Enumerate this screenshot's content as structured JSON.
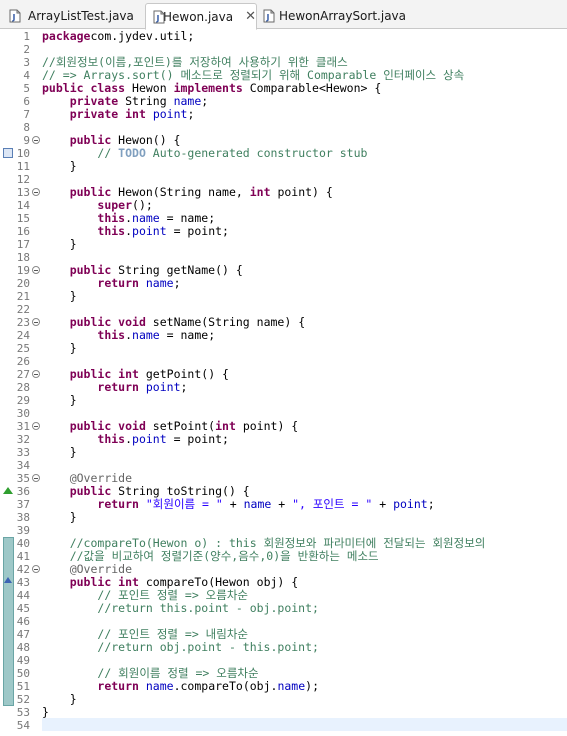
{
  "tabs": [
    {
      "label": "ArrayListTest.java",
      "active": false
    },
    {
      "label": "Hewon.java",
      "active": true,
      "close": "✕"
    },
    {
      "label": "HewonArraySort.java",
      "active": false
    }
  ],
  "editor": {
    "lines": [
      {
        "n": "1",
        "t": [
          [
            "kw",
            "package"
          ],
          [
            "",
            "com.jydev.util;"
          ]
        ]
      },
      {
        "n": "2",
        "t": []
      },
      {
        "n": "3",
        "t": [
          [
            "cm",
            "//회원정보(이름,포인트)를 저장하여 사용하기 위한 클래스"
          ]
        ]
      },
      {
        "n": "4",
        "t": [
          [
            "cm",
            "// => Arrays.sort() 메소드로 정렬되기 위해 Comparable 인터페이스 상속"
          ]
        ]
      },
      {
        "n": "5",
        "t": [
          [
            "kw",
            "public class"
          ],
          [
            "",
            " Hewon "
          ],
          [
            "kw",
            "implements"
          ],
          [
            "",
            " Comparable<Hewon> {"
          ]
        ]
      },
      {
        "n": "6",
        "t": [
          [
            "",
            "    "
          ],
          [
            "kw",
            "private"
          ],
          [
            "",
            " String "
          ],
          [
            "fld",
            "name"
          ],
          [
            "",
            ";"
          ]
        ]
      },
      {
        "n": "7",
        "t": [
          [
            "",
            "    "
          ],
          [
            "kw",
            "private int"
          ],
          [
            "",
            " "
          ],
          [
            "fld",
            "point"
          ],
          [
            "",
            ";"
          ]
        ]
      },
      {
        "n": "8",
        "t": []
      },
      {
        "n": "9",
        "fold": true,
        "t": [
          [
            "",
            "    "
          ],
          [
            "kw",
            "public"
          ],
          [
            "",
            " Hewon() {"
          ]
        ]
      },
      {
        "n": "10",
        "t": [
          [
            "",
            "        "
          ],
          [
            "cm",
            "// "
          ],
          [
            "task",
            "TODO"
          ],
          [
            "cm",
            " Auto-generated constructor stub"
          ]
        ]
      },
      {
        "n": "11",
        "t": [
          [
            "",
            "    }"
          ]
        ]
      },
      {
        "n": "12",
        "t": []
      },
      {
        "n": "13",
        "fold": true,
        "t": [
          [
            "",
            "    "
          ],
          [
            "kw",
            "public"
          ],
          [
            "",
            " Hewon(String name, "
          ],
          [
            "kw",
            "int"
          ],
          [
            "",
            " point) {"
          ]
        ]
      },
      {
        "n": "14",
        "t": [
          [
            "",
            "        "
          ],
          [
            "kw",
            "super"
          ],
          [
            "",
            "();"
          ]
        ]
      },
      {
        "n": "15",
        "t": [
          [
            "",
            "        "
          ],
          [
            "kw",
            "this"
          ],
          [
            "",
            "."
          ],
          [
            "fld",
            "name"
          ],
          [
            "",
            " = name;"
          ]
        ]
      },
      {
        "n": "16",
        "t": [
          [
            "",
            "        "
          ],
          [
            "kw",
            "this"
          ],
          [
            "",
            "."
          ],
          [
            "fld",
            "point"
          ],
          [
            "",
            " = point;"
          ]
        ]
      },
      {
        "n": "17",
        "t": [
          [
            "",
            "    }"
          ]
        ]
      },
      {
        "n": "18",
        "t": []
      },
      {
        "n": "19",
        "fold": true,
        "t": [
          [
            "",
            "    "
          ],
          [
            "kw",
            "public"
          ],
          [
            "",
            " String getName() {"
          ]
        ]
      },
      {
        "n": "20",
        "t": [
          [
            "",
            "        "
          ],
          [
            "kw",
            "return"
          ],
          [
            "",
            " "
          ],
          [
            "fld",
            "name"
          ],
          [
            "",
            ";"
          ]
        ]
      },
      {
        "n": "21",
        "t": [
          [
            "",
            "    }"
          ]
        ]
      },
      {
        "n": "22",
        "t": []
      },
      {
        "n": "23",
        "fold": true,
        "t": [
          [
            "",
            "    "
          ],
          [
            "kw",
            "public void"
          ],
          [
            "",
            " setName(String name) {"
          ]
        ]
      },
      {
        "n": "24",
        "t": [
          [
            "",
            "        "
          ],
          [
            "kw",
            "this"
          ],
          [
            "",
            "."
          ],
          [
            "fld",
            "name"
          ],
          [
            "",
            " = name;"
          ]
        ]
      },
      {
        "n": "25",
        "t": [
          [
            "",
            "    }"
          ]
        ]
      },
      {
        "n": "26",
        "t": []
      },
      {
        "n": "27",
        "fold": true,
        "t": [
          [
            "",
            "    "
          ],
          [
            "kw",
            "public int"
          ],
          [
            "",
            " getPoint() {"
          ]
        ]
      },
      {
        "n": "28",
        "t": [
          [
            "",
            "        "
          ],
          [
            "kw",
            "return"
          ],
          [
            "",
            " "
          ],
          [
            "fld",
            "point"
          ],
          [
            "",
            ";"
          ]
        ]
      },
      {
        "n": "29",
        "t": [
          [
            "",
            "    }"
          ]
        ]
      },
      {
        "n": "30",
        "t": []
      },
      {
        "n": "31",
        "fold": true,
        "t": [
          [
            "",
            "    "
          ],
          [
            "kw",
            "public void"
          ],
          [
            "",
            " setPoint("
          ],
          [
            "kw",
            "int"
          ],
          [
            "",
            " point) {"
          ]
        ]
      },
      {
        "n": "32",
        "t": [
          [
            "",
            "        "
          ],
          [
            "kw",
            "this"
          ],
          [
            "",
            "."
          ],
          [
            "fld",
            "point"
          ],
          [
            "",
            " = point;"
          ]
        ]
      },
      {
        "n": "33",
        "t": [
          [
            "",
            "    }"
          ]
        ]
      },
      {
        "n": "34",
        "t": []
      },
      {
        "n": "35",
        "fold": true,
        "t": [
          [
            "",
            "    "
          ],
          [
            "ann",
            "@Override"
          ]
        ]
      },
      {
        "n": "36",
        "t": [
          [
            "",
            "    "
          ],
          [
            "kw",
            "public"
          ],
          [
            "",
            " String toString() {"
          ]
        ]
      },
      {
        "n": "37",
        "t": [
          [
            "",
            "        "
          ],
          [
            "kw",
            "return"
          ],
          [
            "",
            " "
          ],
          [
            "str",
            "\"회원이름 = \""
          ],
          [
            "",
            " + "
          ],
          [
            "fld",
            "name"
          ],
          [
            "",
            " + "
          ],
          [
            "str",
            "\", 포인트 = \""
          ],
          [
            "",
            " + "
          ],
          [
            "fld",
            "point"
          ],
          [
            "",
            ";"
          ]
        ]
      },
      {
        "n": "38",
        "t": [
          [
            "",
            "    }"
          ]
        ]
      },
      {
        "n": "39",
        "t": []
      },
      {
        "n": "40",
        "t": [
          [
            "",
            "    "
          ],
          [
            "cm",
            "//compareTo(Hewon o) : this 회원정보와 파라미터에 전달되는 회원정보의"
          ]
        ]
      },
      {
        "n": "41",
        "t": [
          [
            "",
            "    "
          ],
          [
            "cm",
            "//값을 비교하여 정렬기준(양수,음수,0)을 반환하는 메소드"
          ]
        ]
      },
      {
        "n": "42",
        "fold": true,
        "t": [
          [
            "",
            "    "
          ],
          [
            "ann",
            "@Override"
          ]
        ]
      },
      {
        "n": "43",
        "t": [
          [
            "",
            "    "
          ],
          [
            "kw",
            "public int"
          ],
          [
            "",
            " compareTo(Hewon obj) {"
          ]
        ]
      },
      {
        "n": "44",
        "t": [
          [
            "",
            "        "
          ],
          [
            "cm",
            "// 포인트 정렬 => 오름차순"
          ]
        ]
      },
      {
        "n": "45",
        "t": [
          [
            "",
            "        "
          ],
          [
            "cm",
            "//return this.point - obj.point;"
          ]
        ]
      },
      {
        "n": "46",
        "t": []
      },
      {
        "n": "47",
        "t": [
          [
            "",
            "        "
          ],
          [
            "cm",
            "// 포인트 정렬 => 내림차순"
          ]
        ]
      },
      {
        "n": "48",
        "t": [
          [
            "",
            "        "
          ],
          [
            "cm",
            "//return obj.point - this.point;"
          ]
        ]
      },
      {
        "n": "49",
        "t": []
      },
      {
        "n": "50",
        "t": [
          [
            "",
            "        "
          ],
          [
            "cm",
            "// 회원이름 정렬 => 오름차순"
          ]
        ]
      },
      {
        "n": "51",
        "t": [
          [
            "",
            "        "
          ],
          [
            "kw",
            "return"
          ],
          [
            "",
            " "
          ],
          [
            "fld",
            "name"
          ],
          [
            "",
            ".compareTo(obj."
          ],
          [
            "fld",
            "name"
          ],
          [
            "",
            ");"
          ]
        ]
      },
      {
        "n": "52",
        "t": [
          [
            "",
            "    }"
          ]
        ]
      },
      {
        "n": "53",
        "t": [
          [
            "",
            "}"
          ]
        ]
      },
      {
        "n": "54",
        "t": []
      }
    ]
  },
  "colors": {
    "keyword": "#7f0055",
    "comment": "#3f7f5f",
    "string": "#2a00ff",
    "field": "#0000c0",
    "annotation": "#646464",
    "current_line": "#e8f2fe"
  }
}
